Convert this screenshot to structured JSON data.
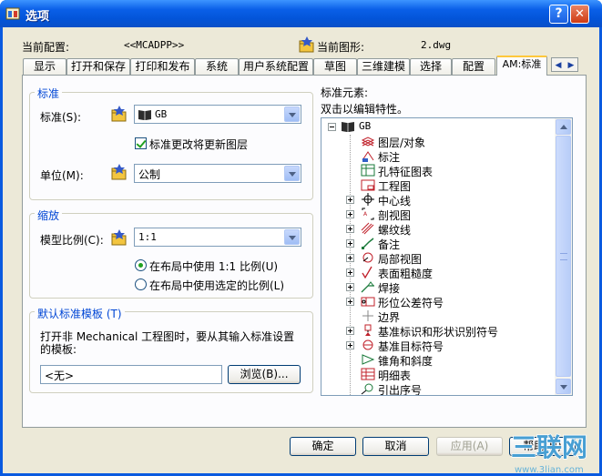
{
  "window": {
    "title": "选项",
    "help_label": "?",
    "close_label": "✕"
  },
  "header": {
    "profile_label": "当前配置:",
    "profile_value": "<<MCADPP>>",
    "drawing_label": "当前图形:",
    "drawing_value": "2.dwg"
  },
  "tabs": [
    {
      "label": "显示"
    },
    {
      "label": "打开和保存"
    },
    {
      "label": "打印和发布"
    },
    {
      "label": "系统"
    },
    {
      "label": "用户系统配置"
    },
    {
      "label": "草图"
    },
    {
      "label": "三维建模"
    },
    {
      "label": "选择"
    },
    {
      "label": "配置"
    },
    {
      "label": "AM:标准"
    }
  ],
  "standard_group": {
    "title": "标准",
    "standard_label": "标准(S):",
    "standard_value": "GB",
    "update_checkbox_label": "标准更改将更新图层",
    "unit_label": "单位(M):",
    "unit_value": "公制"
  },
  "scale_group": {
    "title": "缩放",
    "scale_label": "模型比例(C):",
    "scale_value": "1:1",
    "radio_layout_1to1": "在布局中使用 1:1 比例(U)",
    "radio_layout_selected": "在布局中使用选定的比例(L)"
  },
  "template_group": {
    "title": "默认标准模板 (T)",
    "description": "打开非 Mechanical 工程图时，要从其输入标准设置的模板:",
    "template_value": "<无>",
    "browse_label": "浏览(B)..."
  },
  "elements": {
    "title": "标准元素:",
    "hint": "双击以编辑特性。",
    "root": "GB",
    "items": [
      {
        "label": "图层/对象",
        "icon": "layers-icon",
        "expandable": false
      },
      {
        "label": "标注",
        "icon": "dimension-icon",
        "expandable": false
      },
      {
        "label": "孔特征图表",
        "icon": "hole-chart-icon",
        "expandable": false
      },
      {
        "label": "工程图",
        "icon": "drawing-icon",
        "expandable": false
      },
      {
        "label": "中心线",
        "icon": "centerline-icon",
        "expandable": true
      },
      {
        "label": "剖视图",
        "icon": "section-view-icon",
        "expandable": true
      },
      {
        "label": "螺纹线",
        "icon": "thread-icon",
        "expandable": true
      },
      {
        "label": "备注",
        "icon": "note-icon",
        "expandable": true
      },
      {
        "label": "局部视图",
        "icon": "detail-view-icon",
        "expandable": true
      },
      {
        "label": "表面粗糙度",
        "icon": "surface-texture-icon",
        "expandable": true
      },
      {
        "label": "焊接",
        "icon": "weld-icon",
        "expandable": true
      },
      {
        "label": "形位公差符号",
        "icon": "tolerance-icon",
        "expandable": true
      },
      {
        "label": "边界",
        "icon": "border-icon",
        "expandable": false
      },
      {
        "label": "基准标识和形状识别符号",
        "icon": "datum-id-icon",
        "expandable": true
      },
      {
        "label": "基准目标符号",
        "icon": "datum-target-icon",
        "expandable": true
      },
      {
        "label": "锥角和斜度",
        "icon": "taper-icon",
        "expandable": false
      },
      {
        "label": "明细表",
        "icon": "parts-list-icon",
        "expandable": false
      },
      {
        "label": "引出序号",
        "icon": "balloon-icon",
        "expandable": false
      }
    ]
  },
  "buttons": {
    "ok": "确定",
    "cancel": "取消",
    "apply": "应用(A)",
    "help": "帮助(H)"
  },
  "watermark": {
    "text": "三联网",
    "subtext": "www.3lian.com"
  }
}
